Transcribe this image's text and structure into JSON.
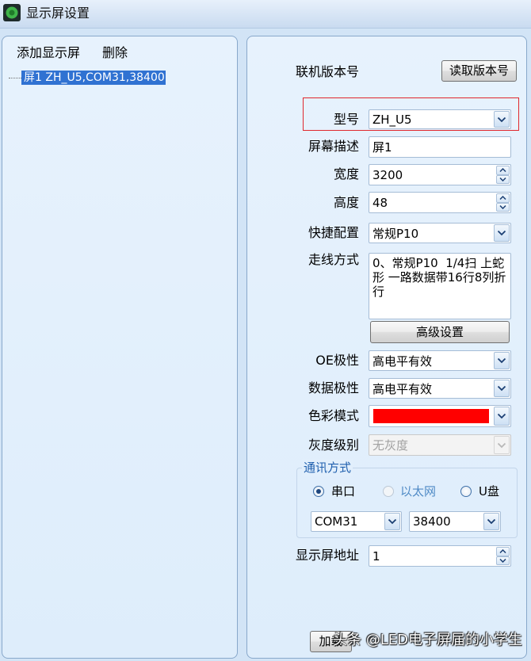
{
  "window": {
    "title": "显示屏设置",
    "icon": "app-icon"
  },
  "left_panel": {
    "add_label": "添加显示屏",
    "delete_label": "删除",
    "tree": [
      {
        "label": "屏1 ZH_U5,COM31,38400",
        "selected": true
      }
    ]
  },
  "right_panel": {
    "version": {
      "label": "联机版本号",
      "button": "读取版本号"
    },
    "model": {
      "label": "型号",
      "value": "ZH_U5"
    },
    "description": {
      "label": "屏幕描述",
      "value": "屏1"
    },
    "width": {
      "label": "宽度",
      "value": "3200"
    },
    "height": {
      "label": "高度",
      "value": "48"
    },
    "quick_config": {
      "label": "快捷配置",
      "value": "常规P10"
    },
    "wiring": {
      "label": "走线方式",
      "value": "0、常规P10  1/4扫 上蛇形 一路数据带16行8列折行"
    },
    "advanced_button": "高级设置",
    "oe_polarity": {
      "label": "OE极性",
      "value": "高电平有效"
    },
    "data_polarity": {
      "label": "数据极性",
      "value": "高电平有效"
    },
    "color_mode": {
      "label": "色彩模式",
      "swatch": "#ff0000"
    },
    "gray_level": {
      "label": "灰度级别",
      "value": "无灰度",
      "disabled": true
    },
    "comm": {
      "legend": "通讯方式",
      "options": [
        {
          "label": "串口",
          "checked": true,
          "disabled": false
        },
        {
          "label": "以太网",
          "checked": false,
          "disabled": true
        },
        {
          "label": "U盘",
          "checked": false,
          "disabled": false
        }
      ],
      "port": "COM31",
      "baud": "38400"
    },
    "address": {
      "label": "显示屏地址",
      "value": "1"
    },
    "load_button": "加载"
  },
  "watermark": "头条 @LED电子屏届的小学生",
  "colors": {
    "selection": "#3072d2",
    "highlight_box": "#e0282e"
  }
}
